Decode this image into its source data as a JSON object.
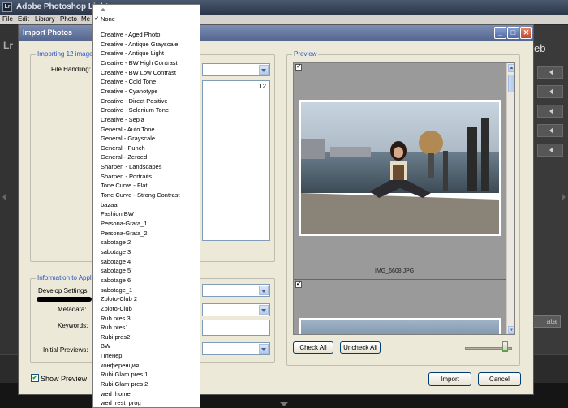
{
  "app": {
    "title": "Adobe Photoshop Light",
    "logo": "Lr",
    "menu": [
      "File",
      "Edit",
      "Library",
      "Photo",
      "Me"
    ],
    "right_partial_text": "eb",
    "right_partial_button": "ata"
  },
  "dialog": {
    "title": "Import Photos",
    "buttons": {
      "minimize": "_",
      "maximize": "□",
      "close": "✕"
    },
    "importing_group": "Importing 12 images",
    "file_handling_label": "File Handling:",
    "file_count": "12",
    "info_group": "Information to Apply",
    "develop_settings_label": "Develop Settings:",
    "metadata_label": "Metadata:",
    "keywords_label": "Keywords:",
    "initial_previews_label": "Initial Previews:",
    "preview_group": "Preview",
    "preview_filename": "IMG_6608.JPG",
    "check_all": "Check All",
    "uncheck_all": "Uncheck All",
    "show_preview_label": "Show Preview",
    "show_preview_checked": true,
    "import_button": "Import",
    "cancel_button": "Cancel",
    "thumbnail_size": 0.85
  },
  "dropdown": {
    "selected": "None",
    "items": [
      "Creative - Aged Photo",
      "Creative - Antique Grayscale",
      "Creative - Antique Light",
      "Creative - BW High Contrast",
      "Creative - BW Low Contrast",
      "Creative - Cold Tone",
      "Creative - Cyanotype",
      "Creative - Direct Positive",
      "Creative - Selenium Tone",
      "Creative - Sepia",
      "General - Auto Tone",
      "General - Grayscale",
      "General - Punch",
      "General - Zeroed",
      "Sharpen - Landscapes",
      "Sharpen - Portraits",
      "Tone Curve - Flat",
      "Tone Curve - Strong Contrast",
      "bazaar",
      "Fashion BW",
      "Persona-Grata_1",
      "Persona-Grata_2",
      "sabotage 2",
      "sabotage 3",
      "sabotage 4",
      "sabotage 5",
      "sabotage 6",
      "sabotage_1",
      "Zoloto-Club 2",
      "Zoloto-Club",
      "Rub pres 3",
      "Rub pres1",
      "Rubi pres2",
      "BW",
      "Пленер",
      "конференция",
      "Rubi Glam pres 1",
      "Rubi Glam pres 2",
      "wed_home",
      "wed_rest_prog"
    ]
  },
  "icons": {
    "check": "✔",
    "up": "▲",
    "down": "▼"
  }
}
